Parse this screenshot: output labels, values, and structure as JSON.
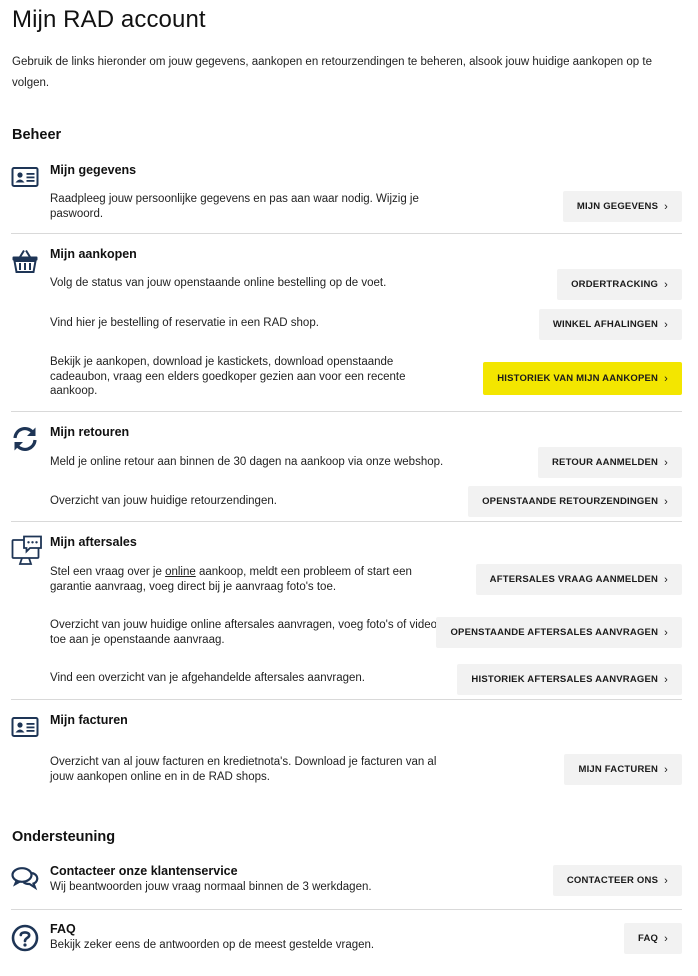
{
  "page": {
    "title": "Mijn RAD account",
    "intro": "Gebruik de links hieronder om jouw gegevens, aankopen en retourzendingen te beheren, alsook jouw huidige aankopen op te volgen."
  },
  "beheer": {
    "heading": "Beheer",
    "gegevens": {
      "title": "Mijn gegevens",
      "text": "Raadpleeg jouw persoonlijke gegevens en pas aan waar nodig. Wijzig je paswoord.",
      "button": "MIJN GEGEVENS"
    },
    "aankopen": {
      "title": "Mijn aankopen",
      "rows": [
        {
          "text": "Volg de status van jouw openstaande online bestelling op de voet.",
          "button": "ORDERTRACKING"
        },
        {
          "text": "Vind hier je bestelling of reservatie in een RAD shop.",
          "button": "WINKEL AFHALINGEN"
        },
        {
          "text": "Bekijk je aankopen, download je kastickets, download openstaande cadeaubon, vraag een elders goedkoper gezien aan voor een recente aankoop.",
          "button": "HISTORIEK VAN MIJN AANKOPEN"
        }
      ]
    },
    "retouren": {
      "title": "Mijn retouren",
      "rows": [
        {
          "text": "Meld je online retour aan binnen de 30 dagen na aankoop via onze webshop.",
          "button": "RETOUR AANMELDEN"
        },
        {
          "text": "Overzicht van jouw huidige retourzendingen.",
          "button": "OPENSTAANDE RETOURZENDINGEN"
        }
      ]
    },
    "aftersales": {
      "title": "Mijn aftersales",
      "row1_before": "Stel een vraag over je ",
      "row1_link": "online",
      "row1_after": " aankoop, meldt een probleem of start een garantie aanvraag, voeg direct bij je aanvraag foto's toe.",
      "row1_button": "AFTERSALES VRAAG AANMELDEN",
      "row2_text": "Overzicht van jouw huidige online aftersales aanvragen, voeg foto's of video's toe aan je openstaande aanvraag.",
      "row2_button": "OPENSTAANDE AFTERSALES AANVRAGEN",
      "row3_text": "Vind een overzicht van je afgehandelde aftersales aanvragen.",
      "row3_button": "HISTORIEK AFTERSALES AANVRAGEN"
    },
    "facturen": {
      "title": "Mijn facturen",
      "text": "Overzicht van al jouw facturen en kredietnota's. Download je facturen van al jouw aankopen online en in de RAD shops.",
      "button": "MIJN FACTUREN"
    }
  },
  "ondersteuning": {
    "heading": "Ondersteuning",
    "klantenservice": {
      "title": "Contacteer onze klantenservice",
      "text": "Wij beantwoorden jouw vraag normaal binnen de 3 werkdagen.",
      "button": "CONTACTEER ONS"
    },
    "faq": {
      "title": "FAQ",
      "text": "Bekijk zeker eens de antwoorden op de meest gestelde vragen.",
      "button": "FAQ"
    }
  },
  "icons": {
    "gegevens": "id-card-icon",
    "aankopen": "basket-icon",
    "retouren": "refresh-arrows-icon",
    "aftersales": "monitor-chat-icon",
    "facturen": "id-card-icon",
    "klantenservice": "chat-bubbles-icon",
    "faq": "question-circle-icon"
  },
  "colors": {
    "accent_yellow": "#f3e600",
    "icon_navy": "#1e3556",
    "button_grey": "#f2f2f2"
  }
}
